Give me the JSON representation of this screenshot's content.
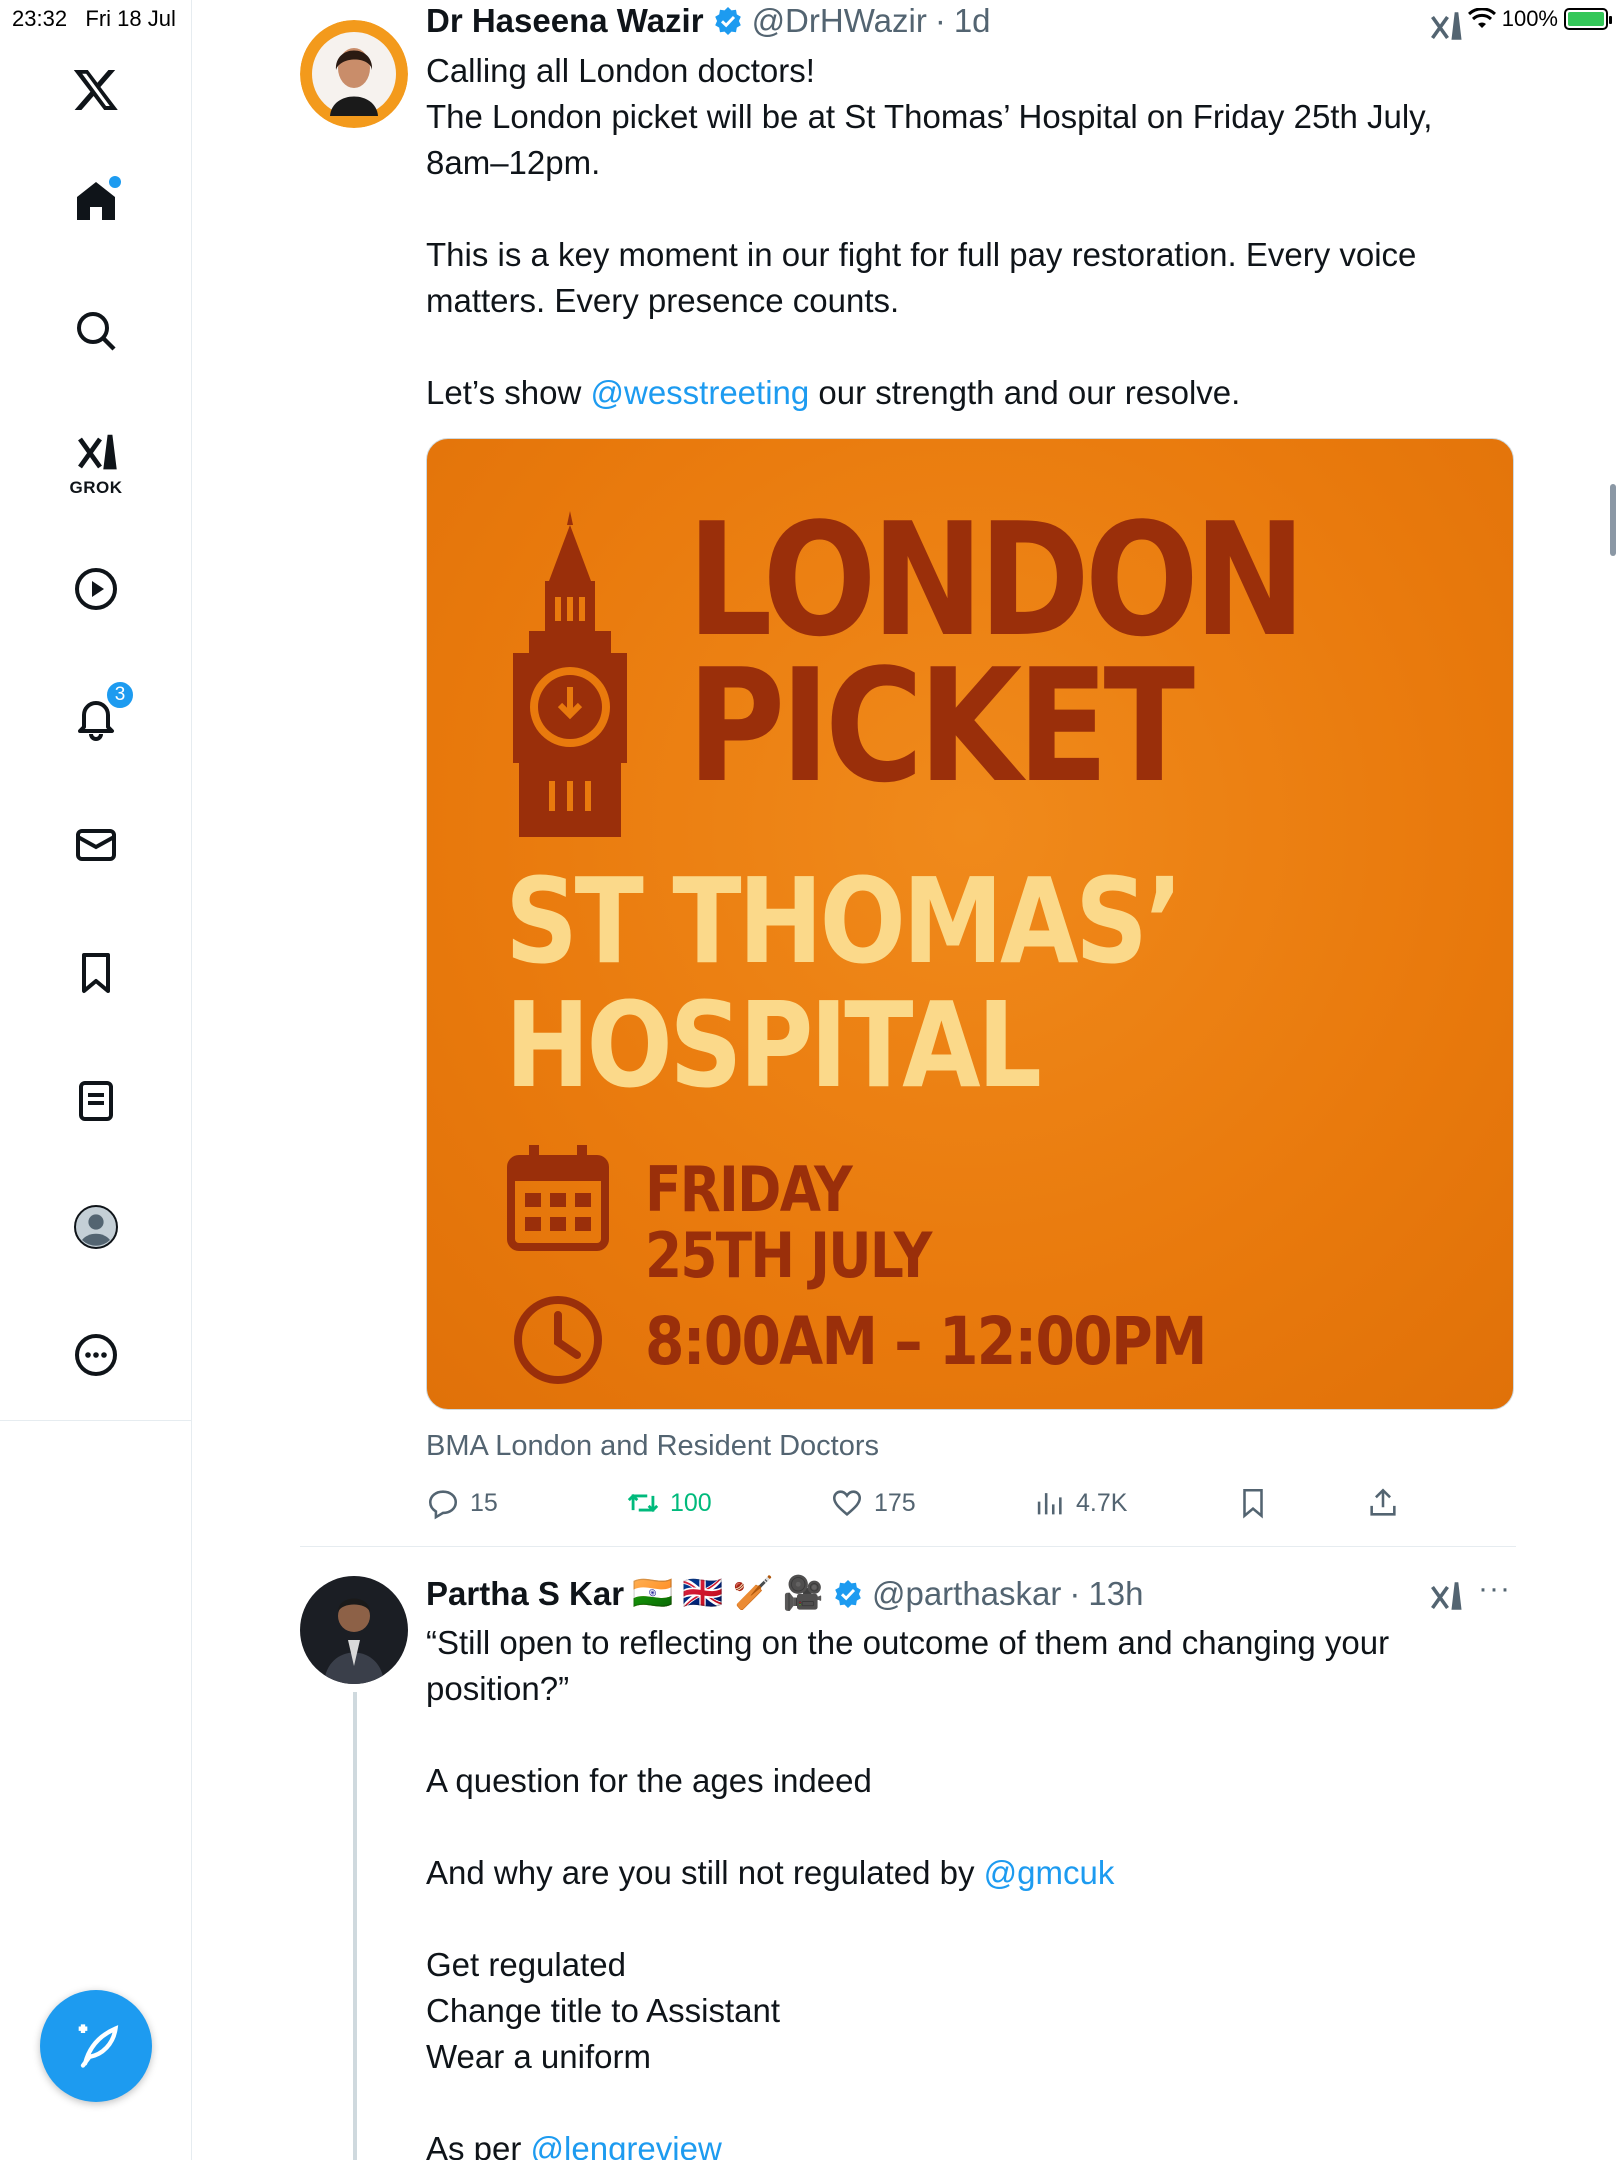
{
  "status_bar": {
    "time": "23:32",
    "date": "Fri 18 Jul",
    "battery": "100%"
  },
  "sidebar": {
    "items": [
      {
        "name": "x-logo"
      },
      {
        "name": "home"
      },
      {
        "name": "search"
      },
      {
        "name": "grok",
        "label": "GROK"
      },
      {
        "name": "video"
      },
      {
        "name": "notifications",
        "badge": "3"
      },
      {
        "name": "messages"
      },
      {
        "name": "bookmarks"
      },
      {
        "name": "lists"
      },
      {
        "name": "profile"
      },
      {
        "name": "more"
      }
    ]
  },
  "tweets": [
    {
      "name": "Dr Haseena Wazir",
      "handle": "@DrHWazir",
      "time": "1d",
      "lines": [
        "Calling all London doctors!",
        "The London picket will be at St Thomas’ Hospital on Friday 25th July,",
        "8am–12pm.",
        "",
        "This is a key moment in our fight for full pay restoration. Every voice",
        "matters. Every presence counts.",
        ""
      ],
      "last_line_pre": "Let’s show ",
      "last_line_mention": "@wesstreeting",
      "last_line_post": " our strength and our resolve.",
      "poster": {
        "title_line1": "LONDON",
        "title_line2": "PICKET",
        "place_line1": "ST THOMAS’",
        "place_line2": "HOSPITAL",
        "date_line1": "FRIDAY",
        "date_line2": "25TH JULY",
        "time": "8:00AM – 12:00PM"
      },
      "media_caption": "BMA London and Resident Doctors",
      "stats": {
        "replies": "15",
        "retweets": "100",
        "likes": "175",
        "views": "4.7K"
      }
    },
    {
      "name": "Partha S Kar",
      "emoji": "🇮🇳 🇬🇧 🏏 🎥",
      "handle": "@parthaskar",
      "time": "13h",
      "lines": [
        "“Still open to reflecting on the outcome of them and changing your",
        "position?”",
        "",
        "A question for the ages indeed",
        ""
      ],
      "gmc_pre": "And why are you still not regulated by ",
      "gmc_mention": "@gmcuk",
      "lines2": [
        "",
        "Get regulated",
        "Change title to Assistant",
        "Wear a uniform",
        ""
      ],
      "last_pre": "As per ",
      "last_mention": "@lengreview"
    }
  ],
  "colors": {
    "accent": "#1d9bf0",
    "retweet": "#00ba7c",
    "poster_orange": "#e97a0d",
    "poster_dark": "#9a2f0a",
    "poster_light": "#fbd98a"
  }
}
